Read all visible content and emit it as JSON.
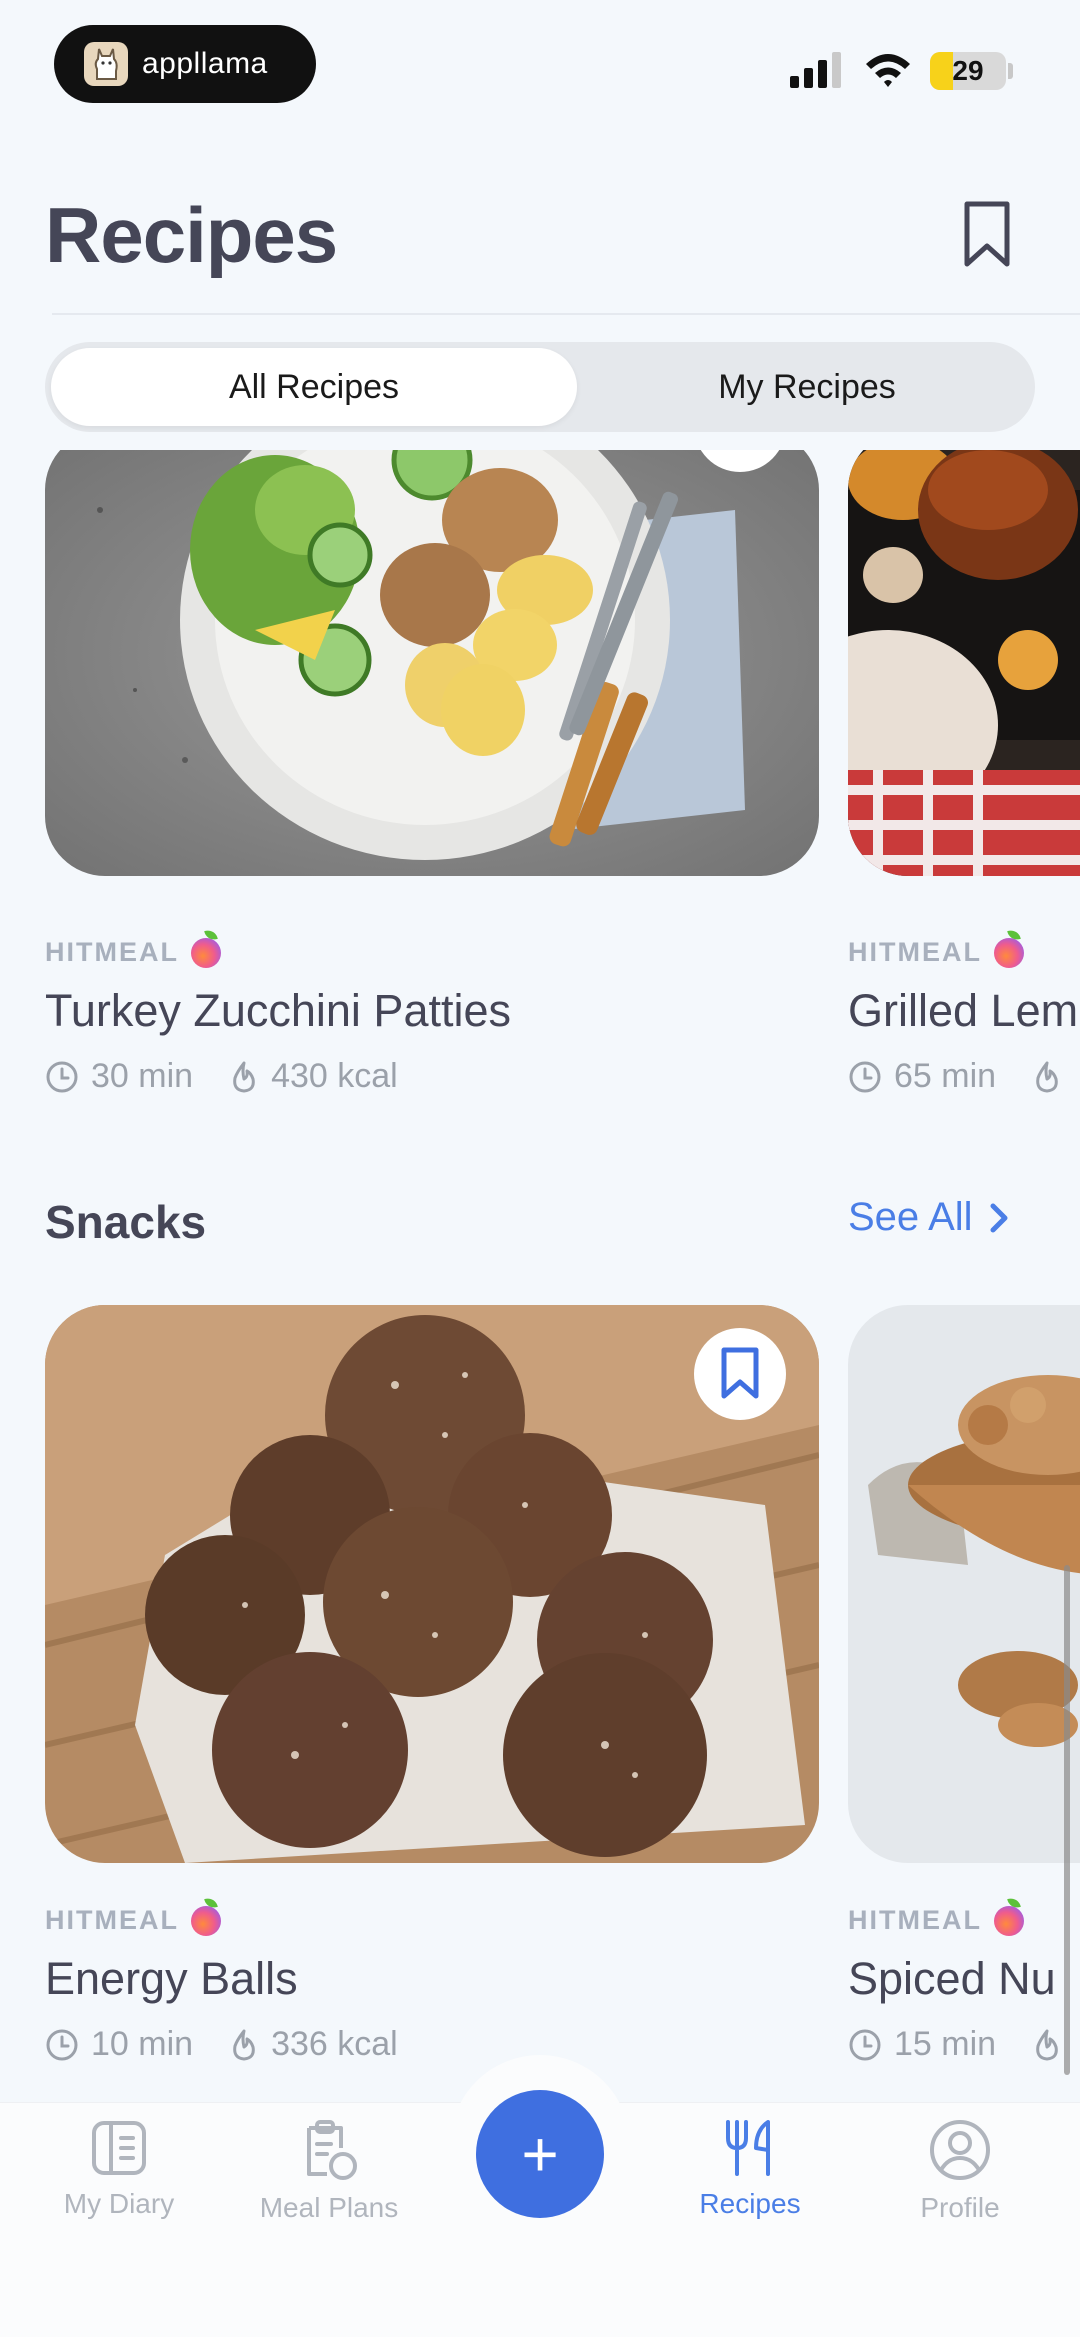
{
  "status_bar": {
    "app_name": "appllama",
    "battery": "29"
  },
  "header": {
    "title": "Recipes"
  },
  "segmented": {
    "all": "All Recipes",
    "mine": "My Recipes"
  },
  "row1": [
    {
      "source": "HITMEAL",
      "name": "Turkey Zucchini Patties",
      "time": "30 min",
      "kcal": "430 kcal"
    },
    {
      "source": "HITMEAL",
      "name": "Grilled Lem",
      "time": "65 min",
      "kcal": ""
    }
  ],
  "snacks": {
    "title": "Snacks",
    "see_all": "See All",
    "cards": [
      {
        "source": "HITMEAL",
        "name": "Energy Balls",
        "time": "10 min",
        "kcal": "336 kcal"
      },
      {
        "source": "HITMEAL",
        "name": "Spiced Nu",
        "time": "15 min",
        "kcal": ""
      }
    ]
  },
  "tabs": [
    {
      "label": "My Diary",
      "icon": "diary-icon"
    },
    {
      "label": "Meal Plans",
      "icon": "meal-plans-icon"
    },
    {
      "label": "Recipes",
      "icon": "fork-knife-icon"
    },
    {
      "label": "Profile",
      "icon": "profile-icon"
    }
  ],
  "fab": "+",
  "colors": {
    "accent": "#4a7ee6",
    "fab": "#3f6fe0",
    "background": "#f4f8fc"
  }
}
